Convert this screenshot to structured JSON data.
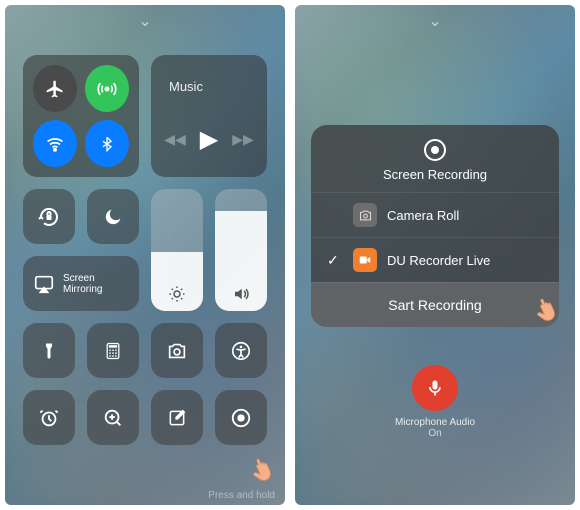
{
  "colors": {
    "green": "#33c45b",
    "blue": "#0a7cff",
    "orange": "#f0802f",
    "darkgray": "#4a4a4a",
    "red": "#e2402f"
  },
  "left": {
    "music_label": "Music",
    "mirror_label": "Screen\nMirroring",
    "hint": "Press and hold"
  },
  "right": {
    "sheet_title": "Screen Recording",
    "options": [
      {
        "label": "Camera Roll",
        "selected": false
      },
      {
        "label": "DU Recorder Live",
        "selected": true
      }
    ],
    "start_label": "Sart Recording",
    "mic_label": "Microphone Audio",
    "mic_state": "On"
  }
}
